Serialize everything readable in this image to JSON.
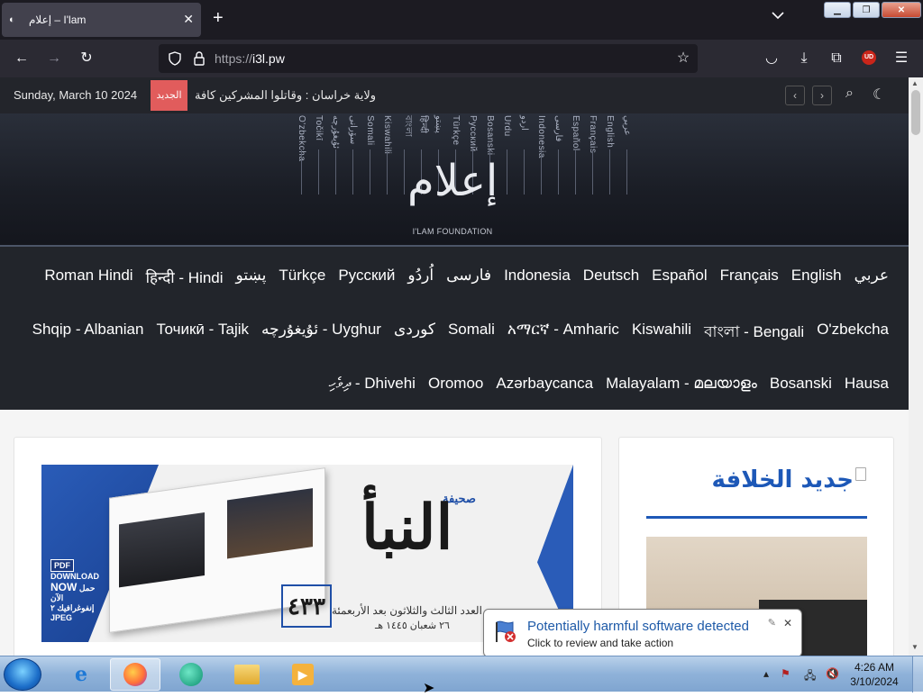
{
  "browser": {
    "tab_title": "إعلام – I'lam",
    "tab_close": "✕",
    "new_tab": "+",
    "url_scheme": "https://",
    "url_host": "i3l.pw",
    "extension_badge": "UD"
  },
  "topbar": {
    "date": "Sunday, March 10 2024",
    "new_badge": "الجديد",
    "ticker": "ولاية خراسان : وقاتلوا المشركين كافة"
  },
  "banner": {
    "languages_vertical": [
      "عربي",
      "English",
      "Français",
      "Español",
      "فارسی",
      "Indonesia",
      "اردو",
      "Urdu",
      "Bosanski",
      "Pусский",
      "Türkçe",
      "پښتو",
      "हिन्दी",
      "বাংলা",
      "Kiswahili",
      "Somali",
      "سۆرانی",
      "ئۇيغۇرچە",
      "Točikī",
      "O'zbekcha"
    ],
    "logo_text": "إعلام",
    "logo_caption": "I'LAM FOUNDATION"
  },
  "languages": {
    "row1": [
      "عربي",
      "English",
      "Français",
      "Español",
      "Deutsch",
      "Indonesia",
      "فارسی",
      "اُردُو",
      "Русский",
      "Türkçe",
      "پښتو",
      "हिन्दी - Hindi",
      "Roman Hindi"
    ],
    "row2": [
      "O'zbekcha",
      "বাংলা - Bengali",
      "Kiswahili",
      "አማርኛ - Amharic",
      "Somali",
      "كوردی",
      "ئۇيغۇرچە - Uyghur",
      "Точикӣ - Tajik",
      "Shqip - Albanian"
    ],
    "row3": [
      "Hausa",
      "Bosanski",
      "Malayalam - മലയാളം",
      "Azərbaycanca",
      "Oromoo",
      "ދިވެހި - Dhivehi"
    ]
  },
  "hero": {
    "pdf_label": "PDF",
    "download_label": "DOWNLOAD",
    "now_label": "NOW",
    "download_ar": "حمل الآن",
    "infographic_ar": "إنفوغرافيك ٢",
    "jpeg_label": "JPEG",
    "paper_small": "صحيفة",
    "paper_title": "النبأ",
    "issue_number": "٤٣٣",
    "issue_text": "العدد الثالث والثلاثون بعد الأربعمئة",
    "issue_date": "٢٦ شعبان ١٤٤٥ هـ"
  },
  "sidebar": {
    "title": "جديد الخلافة"
  },
  "notification": {
    "title": "Potentially harmful software detected",
    "subtitle": "Click to review and take action"
  },
  "taskbar": {
    "time": "4:26 AM",
    "date": "3/10/2024"
  }
}
